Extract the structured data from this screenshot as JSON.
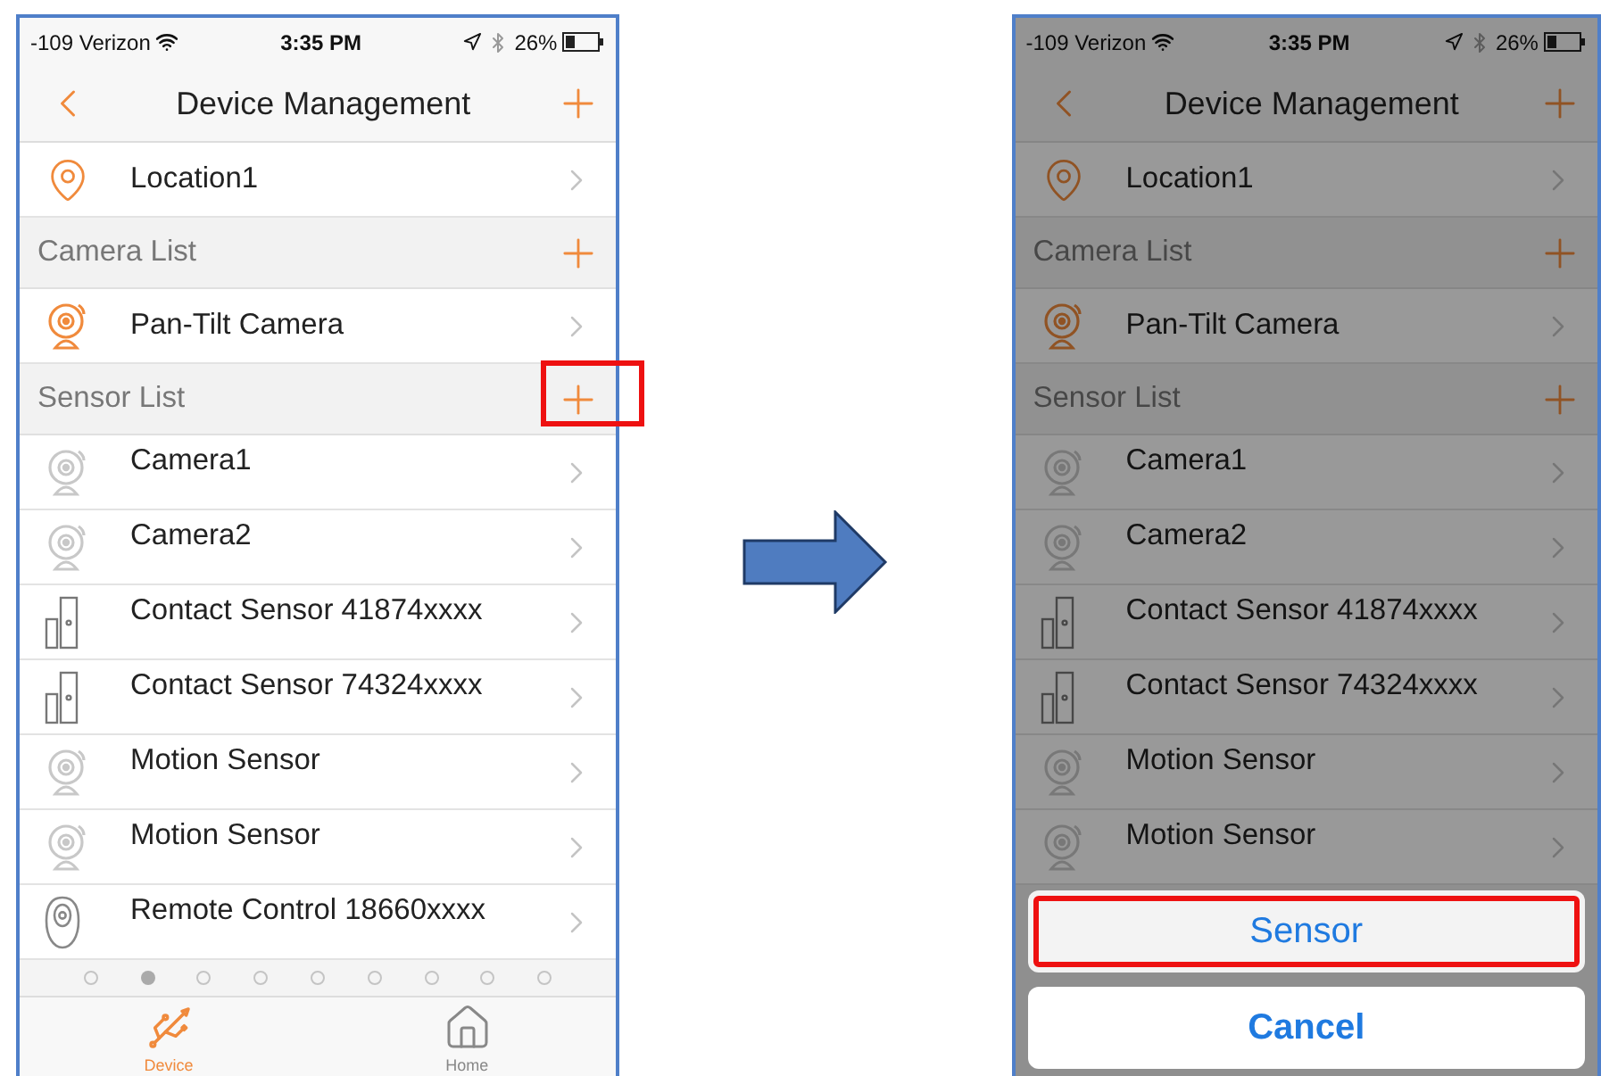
{
  "phones": [
    {
      "status_bar": {
        "carrier": "-109 Verizon",
        "time": "3:35 PM",
        "battery": "26%"
      },
      "nav": {
        "title": "Device Management"
      },
      "location": {
        "label": "Location1",
        "kind": "pin",
        "active": true
      },
      "sections": [
        {
          "title": "Camera List",
          "highlighted": false,
          "rows": [
            {
              "label": "Pan-Tilt Camera",
              "kind": "camera",
              "active": true
            }
          ]
        },
        {
          "title": "Sensor List",
          "highlighted": true,
          "rows": [
            {
              "label": "Camera1",
              "kind": "camera",
              "active": false
            },
            {
              "label": "Camera2",
              "kind": "camera",
              "active": false
            },
            {
              "label": "Contact Sensor 41874xxxx",
              "kind": "contact",
              "active": false
            },
            {
              "label": "Contact Sensor 74324xxxx",
              "kind": "contact",
              "active": false
            },
            {
              "label": "Motion Sensor",
              "kind": "camera",
              "active": false
            },
            {
              "label": "Motion Sensor",
              "kind": "camera",
              "active": false
            },
            {
              "label": "Remote Control 18660xxxx",
              "kind": "remote",
              "active": false
            }
          ]
        }
      ],
      "page_dots": [
        {
          "selected": false
        },
        {
          "selected": true
        },
        {
          "selected": false
        },
        {
          "selected": false
        },
        {
          "selected": false
        },
        {
          "selected": false
        },
        {
          "selected": false
        },
        {
          "selected": false
        },
        {
          "selected": false
        }
      ],
      "tabs": [
        {
          "label": "Device",
          "kind": "device",
          "selected": true
        },
        {
          "label": "Home",
          "kind": "home",
          "selected": false
        }
      ]
    },
    {
      "status_bar": {
        "carrier": "-109 Verizon",
        "time": "3:35 PM",
        "battery": "26%"
      },
      "nav": {
        "title": "Device Management"
      },
      "location": {
        "label": "Location1",
        "kind": "pin",
        "active": true
      },
      "sections": [
        {
          "title": "Camera List",
          "highlighted": false,
          "rows": [
            {
              "label": "Pan-Tilt Camera",
              "kind": "camera",
              "active": true
            }
          ]
        },
        {
          "title": "Sensor List",
          "highlighted": false,
          "rows": [
            {
              "label": "Camera1",
              "kind": "camera",
              "active": false
            },
            {
              "label": "Camera2",
              "kind": "camera",
              "active": false
            },
            {
              "label": "Contact Sensor 41874xxxx",
              "kind": "contact",
              "active": false
            },
            {
              "label": "Contact Sensor 74324xxxx",
              "kind": "contact",
              "active": false
            },
            {
              "label": "Motion Sensor",
              "kind": "camera",
              "active": false
            },
            {
              "label": "Motion Sensor",
              "kind": "camera",
              "active": false
            }
          ]
        }
      ],
      "action_sheet": {
        "options": [
          {
            "label": "Sensor",
            "highlighted": true
          }
        ],
        "cancel": "Cancel"
      }
    }
  ]
}
